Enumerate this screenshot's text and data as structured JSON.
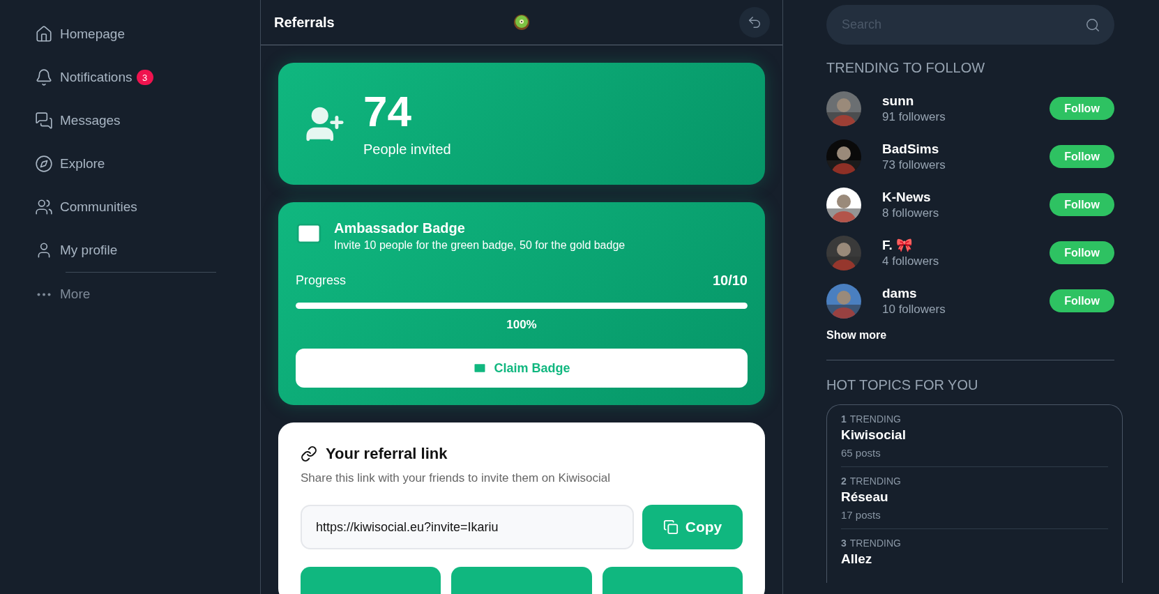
{
  "sidebar": {
    "items": [
      {
        "label": "Homepage",
        "muted": false
      },
      {
        "label": "Notifications",
        "badge": "3",
        "muted": false
      },
      {
        "label": "Messages",
        "muted": false
      },
      {
        "label": "Explore",
        "muted": false
      },
      {
        "label": "Communities",
        "muted": false
      },
      {
        "label": "My profile",
        "muted": false
      },
      {
        "label": "More",
        "muted": true
      }
    ]
  },
  "header": {
    "title": "Referrals"
  },
  "invited": {
    "count": "74",
    "label": "People invited"
  },
  "badge_card": {
    "title": "Ambassador Badge",
    "subtitle": "Invite 10 people for the green badge, 50 for the gold badge",
    "progress_label": "Progress",
    "progress_count": "10/10",
    "level": 1,
    "percent": "100%",
    "button": "Claim Badge"
  },
  "referral": {
    "title": "Your referral link",
    "description": "Share this link with your friends to invite them on Kiwisocial",
    "link": "https://kiwisocial.eu?invite=Ikariu",
    "copy_button": "Copy"
  },
  "search": {
    "placeholder": "Search"
  },
  "trending": {
    "title": "TRENDING TO FOLLOW",
    "users": [
      {
        "name": "sunn",
        "followers": "91 followers",
        "button": "Follow"
      },
      {
        "name": "BadSims",
        "followers": "73 followers",
        "button": "Follow"
      },
      {
        "name": "K-News",
        "followers": "8 followers",
        "button": "Follow"
      },
      {
        "name": "F. 🎀",
        "followers": "4 followers",
        "button": "Follow"
      },
      {
        "name": "dams",
        "followers": "10 followers",
        "button": "Follow"
      }
    ],
    "show_more": "Show more"
  },
  "topics": {
    "title": "HOT TOPICS FOR YOU",
    "items": [
      {
        "rank": "1",
        "tag": "TRENDING",
        "name": "Kiwisocial",
        "posts": "65 posts"
      },
      {
        "rank": "2",
        "tag": "TRENDING",
        "name": "Réseau",
        "posts": "17 posts"
      },
      {
        "rank": "3",
        "tag": "TRENDING",
        "name": "Allez"
      }
    ]
  }
}
